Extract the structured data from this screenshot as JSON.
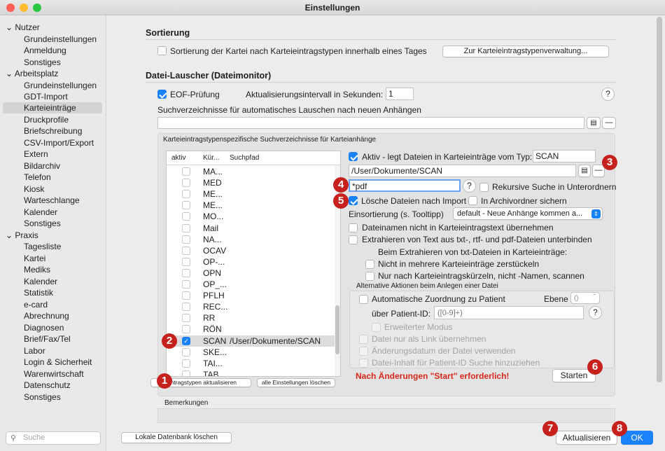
{
  "window": {
    "title": "Einstellungen"
  },
  "sidebar": {
    "groups": [
      {
        "label": "Nutzer",
        "items": [
          "Grundeinstellungen",
          "Anmeldung",
          "Sonstiges"
        ]
      },
      {
        "label": "Arbeitsplatz",
        "items": [
          "Grundeinstellungen",
          "GDT-Import",
          "Karteieinträge",
          "Druckprofile",
          "Briefschreibung",
          "CSV-Import/Export",
          "Extern",
          "Bildarchiv",
          "Telefon",
          "Kiosk",
          "Warteschlange",
          "Kalender",
          "Sonstiges"
        ]
      },
      {
        "label": "Praxis",
        "items": [
          "Tagesliste",
          "Kartei",
          "Mediks",
          "Kalender",
          "Statistik",
          "e-card",
          "Abrechnung",
          "Diagnosen",
          "Brief/Fax/Tel",
          "Labor",
          "Login & Sicherheit",
          "Warenwirtschaft",
          "Datenschutz",
          "Sonstiges"
        ]
      }
    ],
    "selected": "Karteieinträge",
    "search_placeholder": "Suche"
  },
  "sortierung": {
    "heading": "Sortierung",
    "checkbox_label": "Sortierung der Kartei nach Karteieintragstypen innerhalb eines Tages",
    "button": "Zur Karteieintragstypenverwaltung..."
  },
  "lauscher": {
    "heading": "Datei-Lauscher (Dateimonitor)",
    "eof_label": "EOF-Prüfung",
    "interval_label": "Aktualisierungsintervall in Sekunden:",
    "interval_value": "1",
    "suchverz_label": "Suchverzeichnisse für automatisches Lauschen nach neuen Anhängen",
    "group_title": "Karteieintragstypenspezifische Suchverzeichnisse für Karteianhänge"
  },
  "table": {
    "headers": [
      "aktiv",
      "Kür...",
      "Suchpfad"
    ],
    "rows": [
      {
        "kz": "MA...",
        "path": "",
        "on": false
      },
      {
        "kz": "MED",
        "path": "",
        "on": false
      },
      {
        "kz": "ME...",
        "path": "",
        "on": false
      },
      {
        "kz": "ME...",
        "path": "",
        "on": false
      },
      {
        "kz": "MO...",
        "path": "",
        "on": false
      },
      {
        "kz": "Mail",
        "path": "",
        "on": false
      },
      {
        "kz": "NA...",
        "path": "",
        "on": false
      },
      {
        "kz": "OCAV",
        "path": "",
        "on": false
      },
      {
        "kz": "OP-...",
        "path": "",
        "on": false
      },
      {
        "kz": "OPN",
        "path": "",
        "on": false
      },
      {
        "kz": "OP_...",
        "path": "",
        "on": false
      },
      {
        "kz": "PFLH",
        "path": "",
        "on": false
      },
      {
        "kz": "REC...",
        "path": "",
        "on": false
      },
      {
        "kz": "RR",
        "path": "",
        "on": false
      },
      {
        "kz": "RÖN",
        "path": "",
        "on": false
      },
      {
        "kz": "SCAN",
        "path": "/User/Dokumente/SCAN",
        "on": true
      },
      {
        "kz": "SKE...",
        "path": "",
        "on": false
      },
      {
        "kz": "TAI...",
        "path": "",
        "on": false
      },
      {
        "kz": "TAB",
        "path": "",
        "on": false
      }
    ],
    "btn_update": "Eintragstypen aktualisieren",
    "btn_delete": "alle Einstellungen löschen"
  },
  "detail": {
    "aktiv_label": "Aktiv - legt Dateien in Karteieinträge vom Typ:",
    "typ_value": "SCAN",
    "path_value": "/User/Dokumente/SCAN",
    "filter_value": "*pdf",
    "rekursiv_label": "Rekursive Suche in Unterordnern",
    "loesche_label": "Lösche Dateien nach Import",
    "archiv_label": "In Archivordner sichern",
    "einsort_label": "Einsortierung (s. Tooltipp)",
    "einsort_value": "default - Neue Anhänge kommen a...",
    "opt1": "Dateinamen nicht in Karteieintragstext übernehmen",
    "opt2": "Extrahieren von Text aus txt-, rtf- und pdf-Dateien unterbinden",
    "txt_heading": "Beim Extrahieren von txt-Dateien in Karteieinträge:",
    "txt1": "Nicht in mehrere Karteieinträge zerstückeln",
    "txt2": "Nur nach Karteieintragskürzeln, nicht -Namen, scannen",
    "alt_title": "Alternative Aktionen beim Anlegen einer Datei",
    "auto_label": "Automatische Zuordnung zu Patient",
    "ebene_label": "Ebene",
    "ebene_value": "0",
    "patid_label": "über Patient-ID:",
    "patid_placeholder": "([0-9]+)",
    "erw": "Erweiterter Modus",
    "link": "Datei nur als Link übernehmen",
    "aend": "Änderungsdatum der Datei verwenden",
    "inhalt": "Datei-Inhalt für Patient-ID Suche hinzuziehen",
    "warn": "Nach Änderungen \"Start\" erforderlich!",
    "start_btn": "Starten"
  },
  "bemerkungen": "Bemerkungen",
  "footer": {
    "lokal": "Lokale Datenbank löschen",
    "aktualisieren": "Aktualisieren",
    "ok": "OK"
  },
  "badges": [
    "1",
    "2",
    "3",
    "4",
    "5",
    "6",
    "7",
    "8"
  ],
  "colors": {
    "accent": "#1a82fb",
    "badge": "#c6211c",
    "warn": "#d8261c"
  }
}
